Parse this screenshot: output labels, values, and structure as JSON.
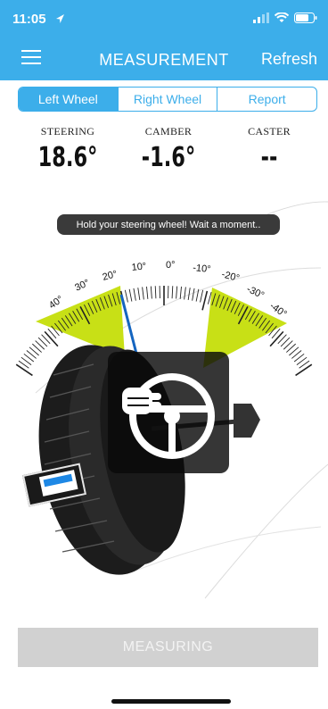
{
  "status_bar": {
    "time": "11:05"
  },
  "nav": {
    "title": "MEASUREMENT",
    "action": "Refresh"
  },
  "tabs": [
    {
      "label": "Left Wheel",
      "active": true
    },
    {
      "label": "Right Wheel",
      "active": false
    },
    {
      "label": "Report",
      "active": false
    }
  ],
  "readings": {
    "steering": {
      "label": "STEERING",
      "value": "18.6°"
    },
    "camber": {
      "label": "CAMBER",
      "value": "-1.6°"
    },
    "caster": {
      "label": "CASTER",
      "value": "--"
    }
  },
  "toast": "Hold your steering wheel! Wait a moment..",
  "gauge": {
    "tick_labels": [
      "40°",
      "30°",
      "20°",
      "10°",
      "0°",
      "-10°",
      "-20°",
      "-30°",
      "-40°"
    ],
    "colors": {
      "zone": "#c8e016",
      "needle": "#1565c0"
    }
  },
  "measure_button": {
    "label": "MEASURING"
  },
  "colors": {
    "accent": "#3caeea",
    "button_disabled": "#d1d1d1"
  }
}
